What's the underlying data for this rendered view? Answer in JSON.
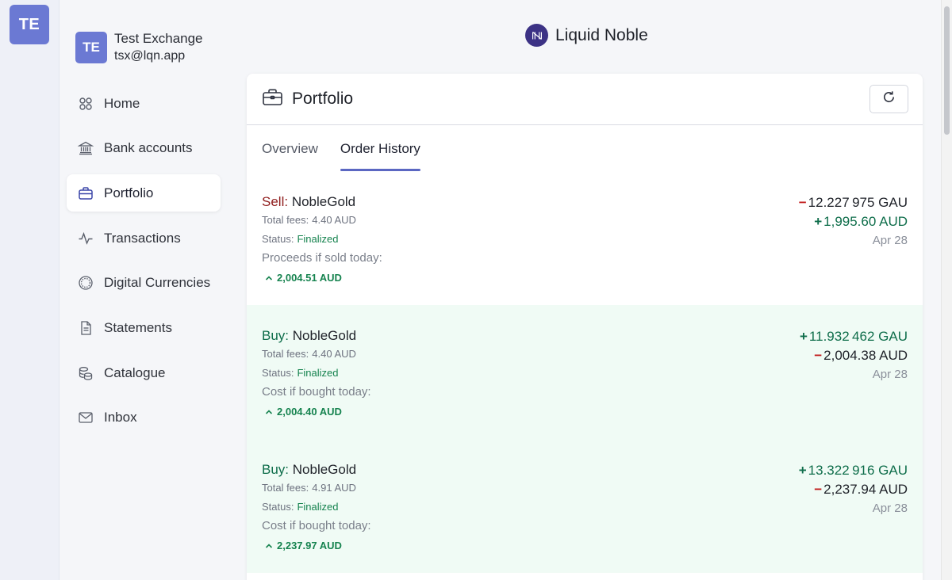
{
  "rail": {
    "avatar_initials": "TE"
  },
  "account": {
    "initials": "TE",
    "name": "Test Exchange",
    "email": "tsx@lqn.app"
  },
  "nav": [
    {
      "label": "Home",
      "icon": "grid-circles-icon"
    },
    {
      "label": "Bank accounts",
      "icon": "bank-icon"
    },
    {
      "label": "Portfolio",
      "icon": "briefcase-icon",
      "active": true
    },
    {
      "label": "Transactions",
      "icon": "activity-icon"
    },
    {
      "label": "Digital Currencies",
      "icon": "coin-icon"
    },
    {
      "label": "Statements",
      "icon": "document-icon"
    },
    {
      "label": "Catalogue",
      "icon": "coins-stack-icon"
    },
    {
      "label": "Inbox",
      "icon": "mail-icon"
    }
  ],
  "brand": {
    "name": "Liquid Noble",
    "logo_color": "#3c3285"
  },
  "card": {
    "title": "Portfolio",
    "tabs": [
      {
        "label": "Overview",
        "active": false
      },
      {
        "label": "Order History",
        "active": true
      }
    ]
  },
  "labels": {
    "total_fees": "Total fees:",
    "status": "Status:"
  },
  "orders": [
    {
      "side": "Sell:",
      "asset": "NobleGold",
      "fees": "4.40 AUD",
      "status": "Finalized",
      "quote_label": "Proceeds if sold today:",
      "quote_value": "2,004.51 AUD",
      "amount1_sign": "−",
      "amount1": "12.227 975 GAU",
      "amount2_sign": "+",
      "amount2": "1,995.60 AUD",
      "date": "Apr 28"
    },
    {
      "side": "Buy:",
      "asset": "NobleGold",
      "fees": "4.40 AUD",
      "status": "Finalized",
      "quote_label": "Cost if bought today:",
      "quote_value": "2,004.40 AUD",
      "amount1_sign": "+",
      "amount1": "11.932 462 GAU",
      "amount2_sign": "−",
      "amount2": "2,004.38 AUD",
      "date": "Apr 28"
    },
    {
      "side": "Buy:",
      "asset": "NobleGold",
      "fees": "4.91 AUD",
      "status": "Finalized",
      "quote_label": "Cost if bought today:",
      "quote_value": "2,237.97 AUD",
      "amount1_sign": "+",
      "amount1": "13.322 916 GAU",
      "amount2_sign": "−",
      "amount2": "2,237.94 AUD",
      "date": "Apr 28"
    }
  ],
  "colors": {
    "accent": "#5b67c2",
    "avatar": "#6b79d3",
    "positive": "#0f6e4b",
    "negative": "#c21f1f",
    "sell": "#8f1c1c"
  }
}
